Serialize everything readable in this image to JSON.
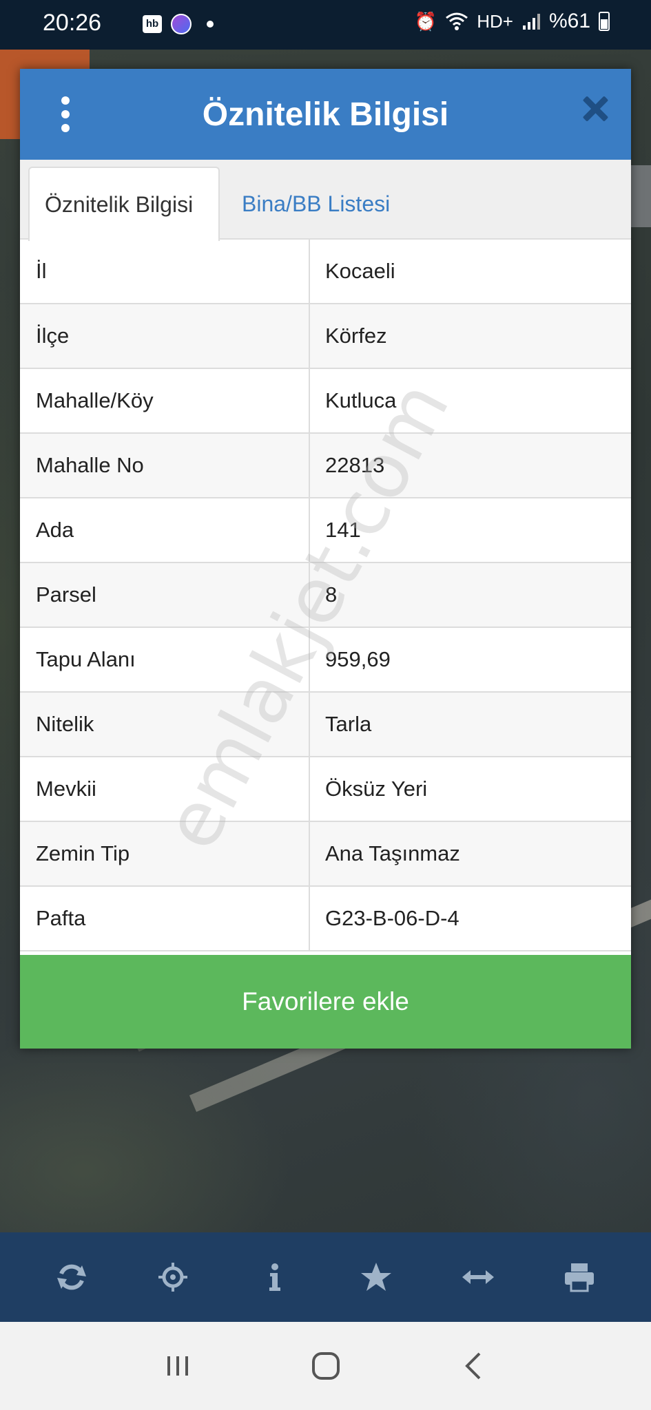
{
  "status": {
    "time": "20:26",
    "hb": "hb",
    "signal_text": "%61"
  },
  "modal": {
    "title": "Öznitelik Bilgisi",
    "tabs": [
      {
        "label": "Öznitelik Bilgisi",
        "active": true
      },
      {
        "label": "Bina/BB Listesi",
        "active": false
      }
    ],
    "rows": [
      {
        "key": "İl",
        "value": "Kocaeli"
      },
      {
        "key": "İlçe",
        "value": "Körfez"
      },
      {
        "key": "Mahalle/Köy",
        "value": "Kutluca"
      },
      {
        "key": "Mahalle No",
        "value": "22813"
      },
      {
        "key": "Ada",
        "value": "141"
      },
      {
        "key": "Parsel",
        "value": "8"
      },
      {
        "key": "Tapu Alanı",
        "value": "959,69"
      },
      {
        "key": "Nitelik",
        "value": "Tarla"
      },
      {
        "key": "Mevkii",
        "value": "Öksüz Yeri"
      },
      {
        "key": "Zemin Tip",
        "value": "Ana Taşınmaz"
      },
      {
        "key": "Pafta",
        "value": "G23-B-06-D-4"
      }
    ],
    "favorite_button": "Favorilere ekle"
  },
  "watermark": "emlakjet.com",
  "toolbar": [
    "refresh-icon",
    "locate-icon",
    "info-icon",
    "star-icon",
    "measure-icon",
    "print-icon"
  ],
  "colors": {
    "header": "#3a7dc4",
    "button": "#5cb85c",
    "toolbar": "#1f3e63"
  }
}
